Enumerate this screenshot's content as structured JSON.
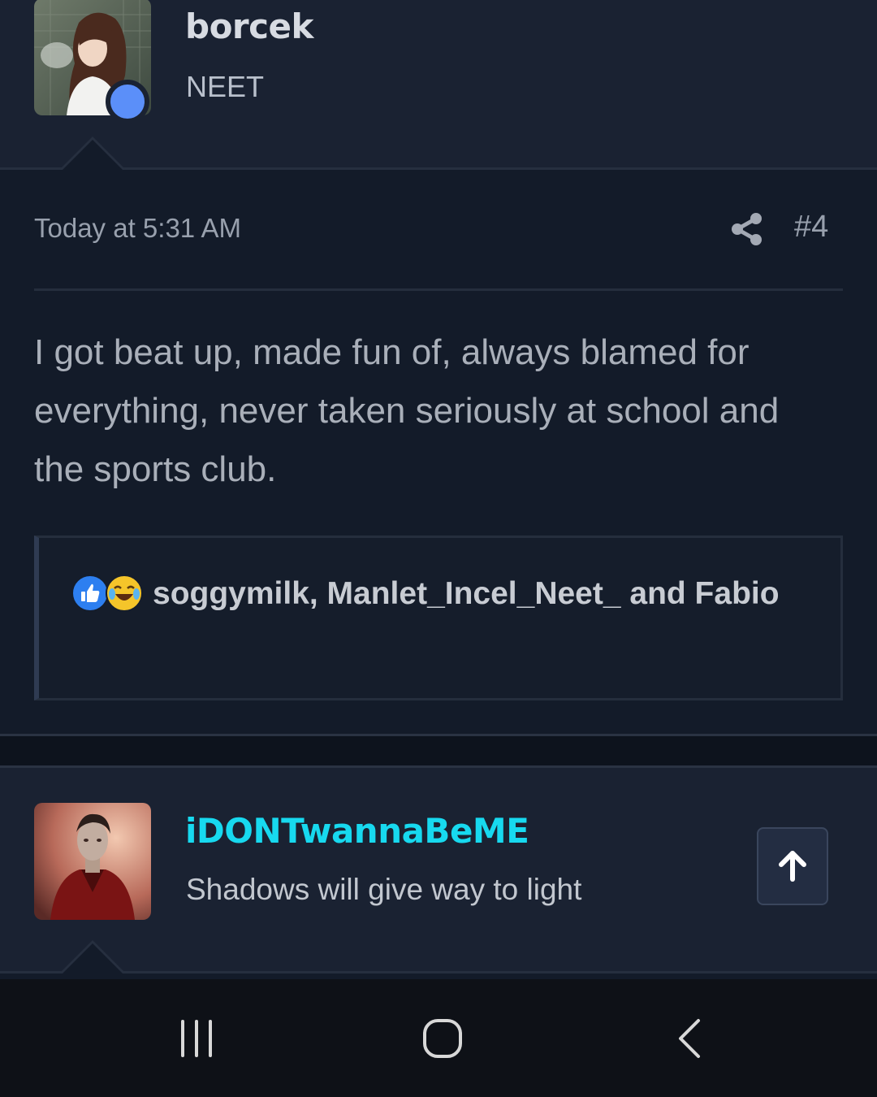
{
  "post1": {
    "author": "borcek",
    "author_title": "NEET",
    "date": "Today at 5:31 AM",
    "number": "#4",
    "body": "I got beat up, made fun of, always blamed for everything, never taken seriously at school and the sports club.",
    "reactions": {
      "icons": [
        "like-icon",
        "laugh-tears-icon"
      ],
      "text": "soggymilk, Manlet_Incel_Neet_ and Fabio"
    }
  },
  "post2": {
    "author": "iDONTwannaBeME",
    "author_title": "Shadows will give way to light"
  },
  "colors": {
    "page_bg": "#131b29",
    "header_bg": "#1a2232",
    "online_dot": "#5b8ff9",
    "username_highlight": "#17d9ef",
    "like_blue": "#2d7ff0",
    "laugh_yellow": "#f5c52a"
  },
  "icons": {
    "share": "share-icon",
    "scroll_top": "arrow-up-icon",
    "nav": [
      "recent-apps-icon",
      "home-icon",
      "back-icon"
    ]
  }
}
